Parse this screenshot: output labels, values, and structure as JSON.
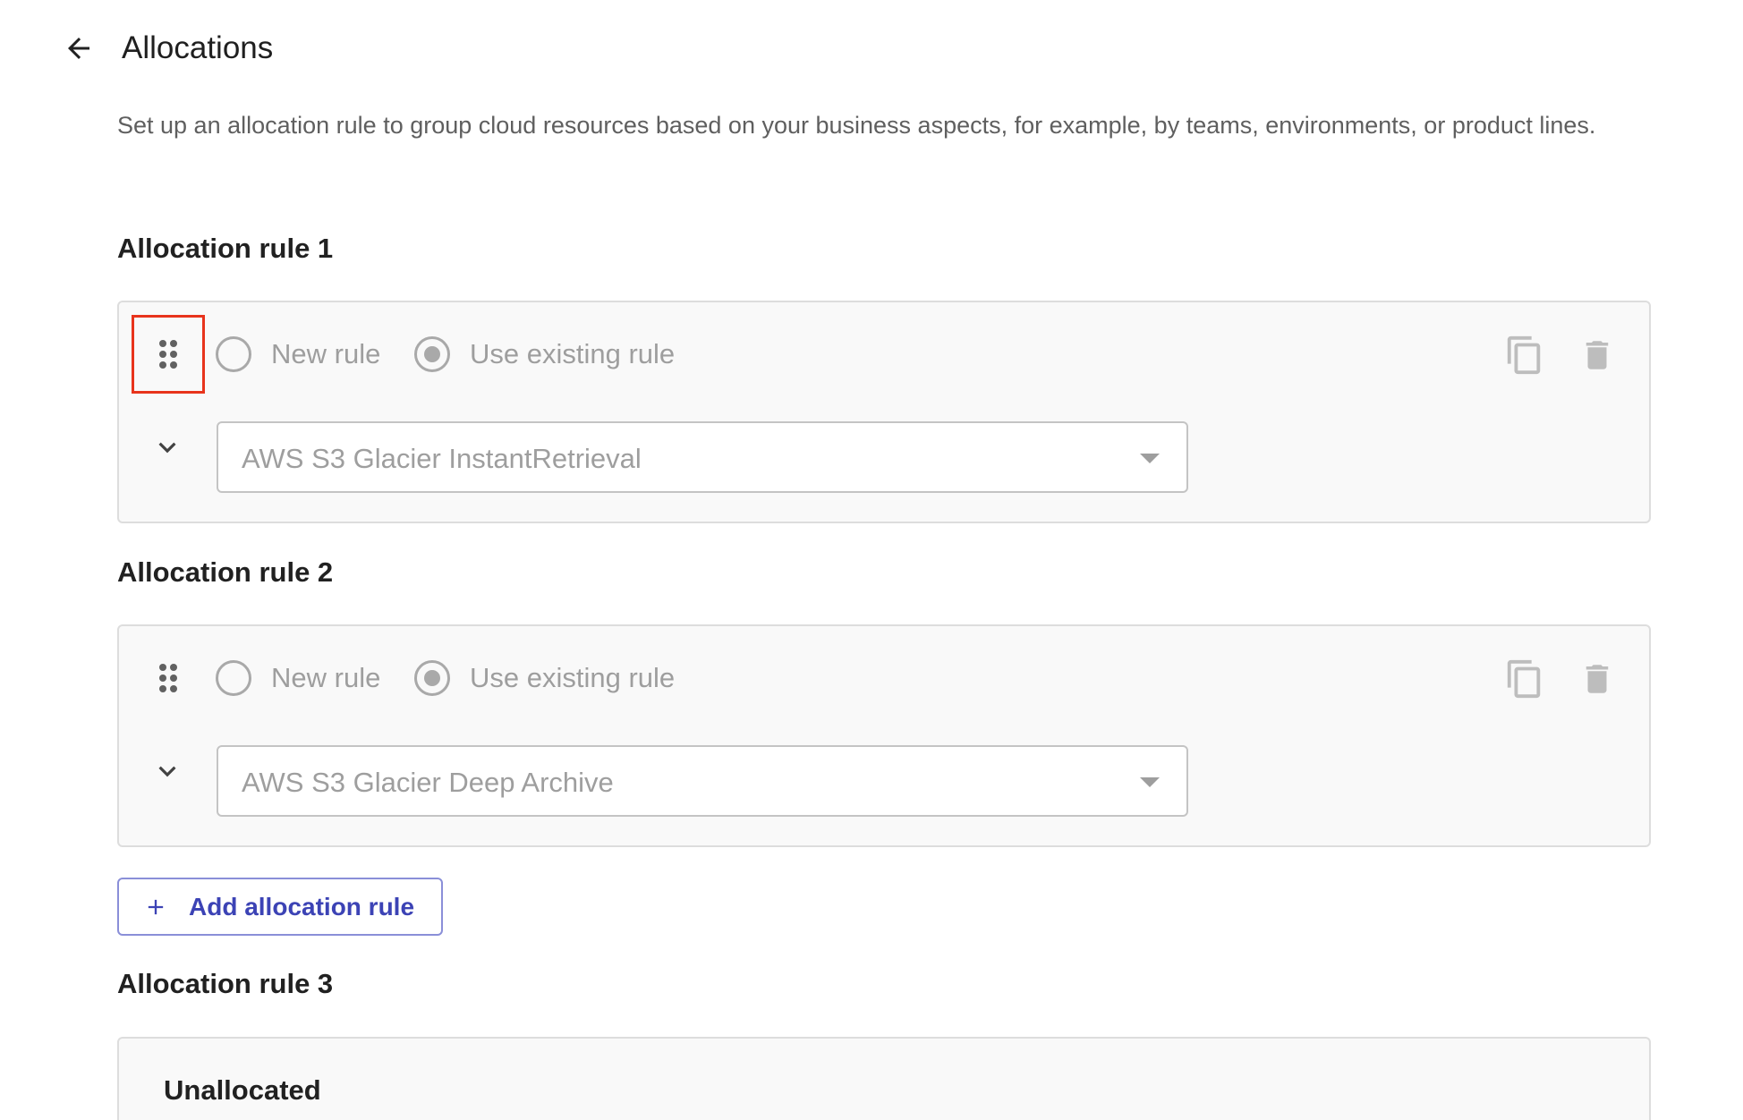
{
  "header": {
    "title": "Allocations",
    "back_icon": "arrow-left-icon"
  },
  "description": "Set up an allocation rule to group cloud resources based on your business aspects, for example, by teams, environments, or product lines.",
  "rules": [
    {
      "title": "Allocation rule 1",
      "new_rule_label": "New rule",
      "existing_rule_label": "Use existing rule",
      "selected_option": "Use existing rule",
      "selected_value": "AWS S3 Glacier InstantRetrieval"
    },
    {
      "title": "Allocation rule 2",
      "new_rule_label": "New rule",
      "existing_rule_label": "Use existing rule",
      "selected_option": "Use existing rule",
      "selected_value": "AWS S3 Glacier Deep Archive"
    }
  ],
  "add_button": {
    "label": "Add allocation rule"
  },
  "rule3": {
    "title": "Allocation rule 3",
    "label": "Unallocated"
  },
  "colors": {
    "accent": "#3c43b5",
    "highlight": "#e8341c",
    "disabled_text": "#9e9e9e",
    "card_background": "#f9f9f9"
  }
}
